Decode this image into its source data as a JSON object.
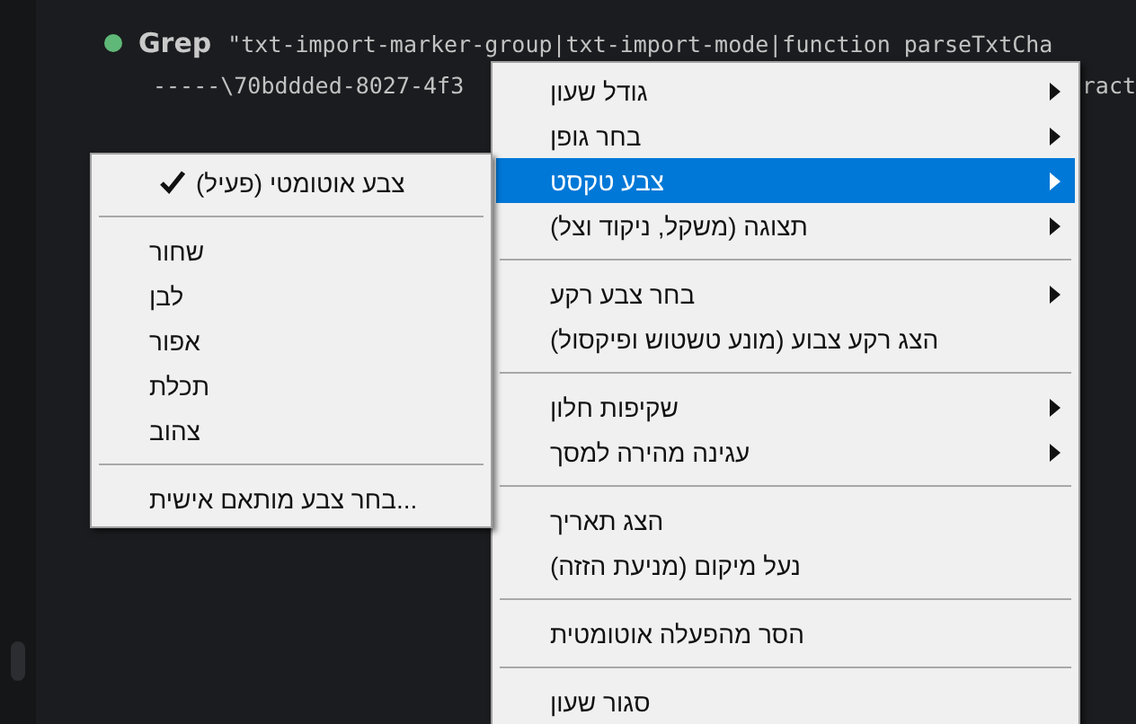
{
  "terminal": {
    "tool_name": "Grep",
    "query_line": "\"txt-import-marker-group|txt-import-mode|function parseTxtCha",
    "path_start": "-----\\70bddded-8027-4f3",
    "path_end": "ract"
  },
  "context_menu": {
    "items": [
      {
        "kind": "item",
        "label": "גודל שעון",
        "submenu": true,
        "selected": false
      },
      {
        "kind": "item",
        "label": "בחר גופן",
        "submenu": true,
        "selected": false
      },
      {
        "kind": "item",
        "label": "צבע טקסט",
        "submenu": true,
        "selected": true
      },
      {
        "kind": "item",
        "label": "תצוגה (משקל, ניקוד וצל)",
        "submenu": true,
        "selected": false
      },
      {
        "kind": "separator"
      },
      {
        "kind": "item",
        "label": "בחר צבע רקע",
        "submenu": true,
        "selected": false
      },
      {
        "kind": "item",
        "label": "הצג רקע צבוע (מונע טשטוש ופיקסול)",
        "submenu": false,
        "selected": false
      },
      {
        "kind": "separator"
      },
      {
        "kind": "item",
        "label": "שקיפות חלון",
        "submenu": true,
        "selected": false
      },
      {
        "kind": "item",
        "label": "עגינה מהירה למסך",
        "submenu": true,
        "selected": false
      },
      {
        "kind": "separator"
      },
      {
        "kind": "item",
        "label": "הצג תאריך",
        "submenu": false,
        "selected": false
      },
      {
        "kind": "item",
        "label": "נעל מיקום (מניעת הזזה)",
        "submenu": false,
        "selected": false
      },
      {
        "kind": "separator"
      },
      {
        "kind": "item",
        "label": "הסר מהפעלה אוטומטית",
        "submenu": false,
        "selected": false
      },
      {
        "kind": "separator"
      },
      {
        "kind": "item",
        "label": "סגור שעון",
        "selected": false
      }
    ]
  },
  "text_color_submenu": {
    "items": [
      {
        "kind": "item",
        "label": "צבע אוטומטי (פעיל)",
        "checked": true
      },
      {
        "kind": "separator"
      },
      {
        "kind": "item",
        "label": "שחור",
        "checked": false
      },
      {
        "kind": "item",
        "label": "לבן",
        "checked": false
      },
      {
        "kind": "item",
        "label": "אפור",
        "checked": false
      },
      {
        "kind": "item",
        "label": "תכלת",
        "checked": false
      },
      {
        "kind": "item",
        "label": "צהוב",
        "checked": false
      },
      {
        "kind": "separator"
      },
      {
        "kind": "item",
        "label": "...בחר צבע מותאם אישית",
        "checked": false
      }
    ]
  }
}
